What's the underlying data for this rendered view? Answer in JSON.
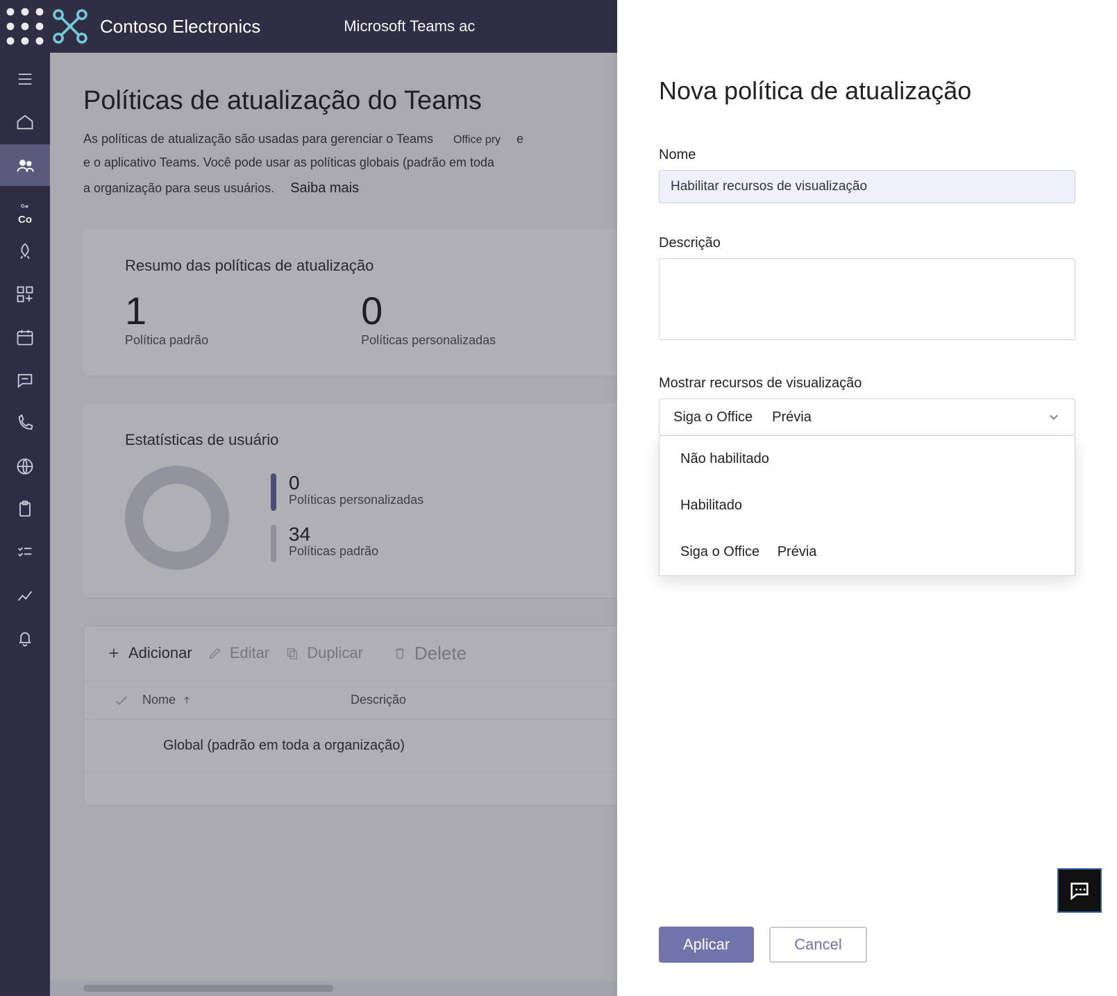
{
  "header": {
    "brand": "Contoso Electronics",
    "app_title": "Microsoft Teams ac"
  },
  "sidebar": {
    "co_label": "Co"
  },
  "page": {
    "title": "Políticas de atualização do Teams",
    "desc_line1a": "As políticas de atualização são usadas para gerenciar o Teams",
    "desc_office_fragment": "Office pry",
    "desc_e_fragment": "e",
    "desc_line2": "e o aplicativo Teams. Você pode usar as políticas globais (padrão em toda",
    "desc_line3": "a organização para seus usuários.",
    "learn_more": "Saiba mais"
  },
  "summary_card": {
    "title": "Resumo das políticas de atualização",
    "items": [
      {
        "value": "1",
        "label": "Política padrão"
      },
      {
        "value": "0",
        "label": "Políticas personalizadas"
      }
    ]
  },
  "stats_card": {
    "title": "Estatísticas de usuário",
    "lines": [
      {
        "value": "0",
        "label": "Políticas personalizadas"
      },
      {
        "value": "34",
        "label": "Políticas padrão"
      }
    ]
  },
  "toolbar": {
    "add": "Adicionar",
    "edit": "Editar",
    "duplicate": "Duplicar",
    "delete": "Delete"
  },
  "table": {
    "col_name": "Nome",
    "col_desc": "Descrição",
    "rows": [
      {
        "name": "Global (padrão em toda a organização)"
      }
    ]
  },
  "panel": {
    "title": "Nova política de atualização",
    "name_label": "Nome",
    "name_value": "Habilitar recursos de visualização",
    "desc_label": "Descrição",
    "desc_value": "",
    "feature_label": "Mostrar recursos de visualização",
    "selected_a": "Siga o Office",
    "selected_b": "Prévia",
    "options": [
      {
        "a": "Não habilitado",
        "b": ""
      },
      {
        "a": "Habilitado",
        "b": ""
      },
      {
        "a": "Siga o Office",
        "b": "Prévia"
      }
    ],
    "apply": "Aplicar",
    "cancel": "Cancel"
  }
}
